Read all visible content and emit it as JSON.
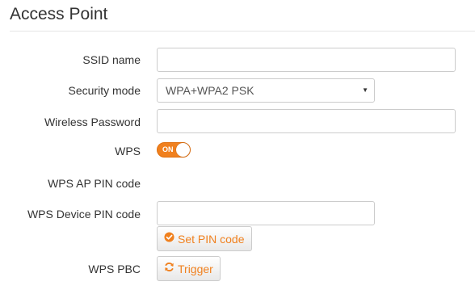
{
  "header": {
    "title": "Access Point"
  },
  "form": {
    "ssid": {
      "label": "SSID name",
      "value": ""
    },
    "security_mode": {
      "label": "Security mode",
      "selected": "WPA+WPA2 PSK"
    },
    "wireless_password": {
      "label": "Wireless Password",
      "value": ""
    },
    "wps": {
      "label": "WPS",
      "toggle_text": "ON",
      "enabled": true
    },
    "wps_ap_pin": {
      "label": "WPS AP PIN code",
      "value": ""
    },
    "wps_device_pin": {
      "label": "WPS Device PIN code",
      "value": "",
      "button_label": "Set PIN code",
      "button_icon": "check-circle-icon"
    },
    "wps_pbc": {
      "label": "WPS PBC",
      "button_label": "Trigger",
      "button_icon": "refresh-icon"
    }
  },
  "colors": {
    "accent": "#f0801e",
    "border": "#cccccc",
    "text": "#333333"
  }
}
